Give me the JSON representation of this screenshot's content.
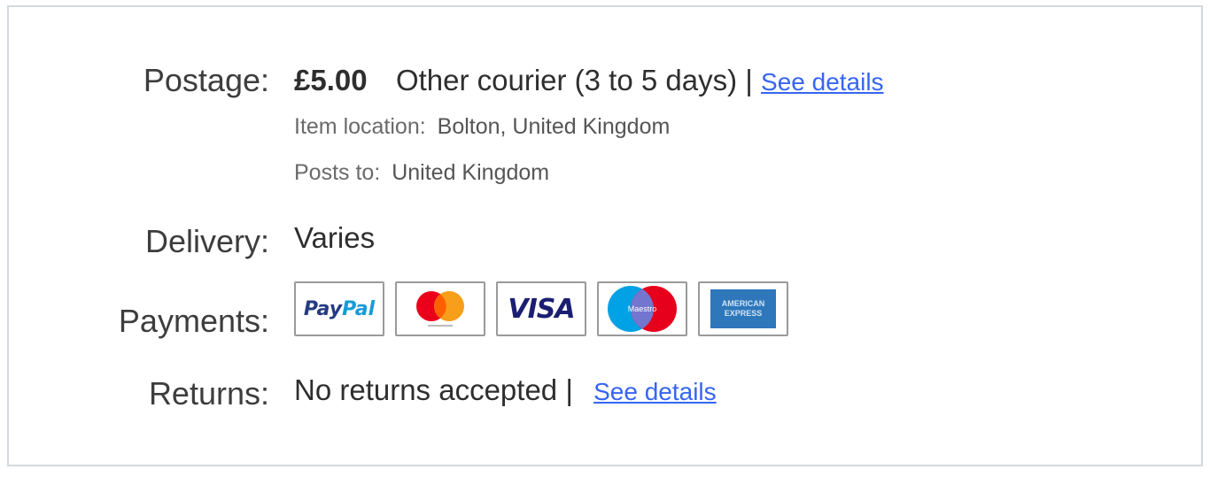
{
  "postage": {
    "label": "Postage:",
    "price": "£5.00",
    "method": "Other courier (3 to 5 days)",
    "separator": "|",
    "details_link": "See details",
    "item_location_label": "Item location:",
    "item_location_value": "Bolton, United Kingdom",
    "posts_to_label": "Posts to:",
    "posts_to_value": "United Kingdom"
  },
  "delivery": {
    "label": "Delivery:",
    "value": "Varies"
  },
  "payments": {
    "label": "Payments:",
    "methods": [
      {
        "name": "paypal",
        "text_pay": "Pay",
        "text_pal": "Pal",
        "colors": [
          "#253b80",
          "#179bd7"
        ]
      },
      {
        "name": "mastercard",
        "colors": [
          "#eb001b",
          "#f79e1b"
        ]
      },
      {
        "name": "visa",
        "text": "VISA",
        "colors": [
          "#1a1f71"
        ]
      },
      {
        "name": "maestro",
        "text": "Maestro",
        "colors": [
          "#00a2e5",
          "#e7001b"
        ]
      },
      {
        "name": "american-express",
        "text": "AMERICAN EXPRESS",
        "colors": [
          "#2e77bb"
        ]
      }
    ]
  },
  "returns": {
    "label": "Returns:",
    "value": "No returns accepted",
    "separator": "|",
    "details_link": "See details"
  },
  "colors": {
    "link": "#3665f3",
    "border": "#d3d8dc",
    "label_text": "#3d3d3d"
  }
}
